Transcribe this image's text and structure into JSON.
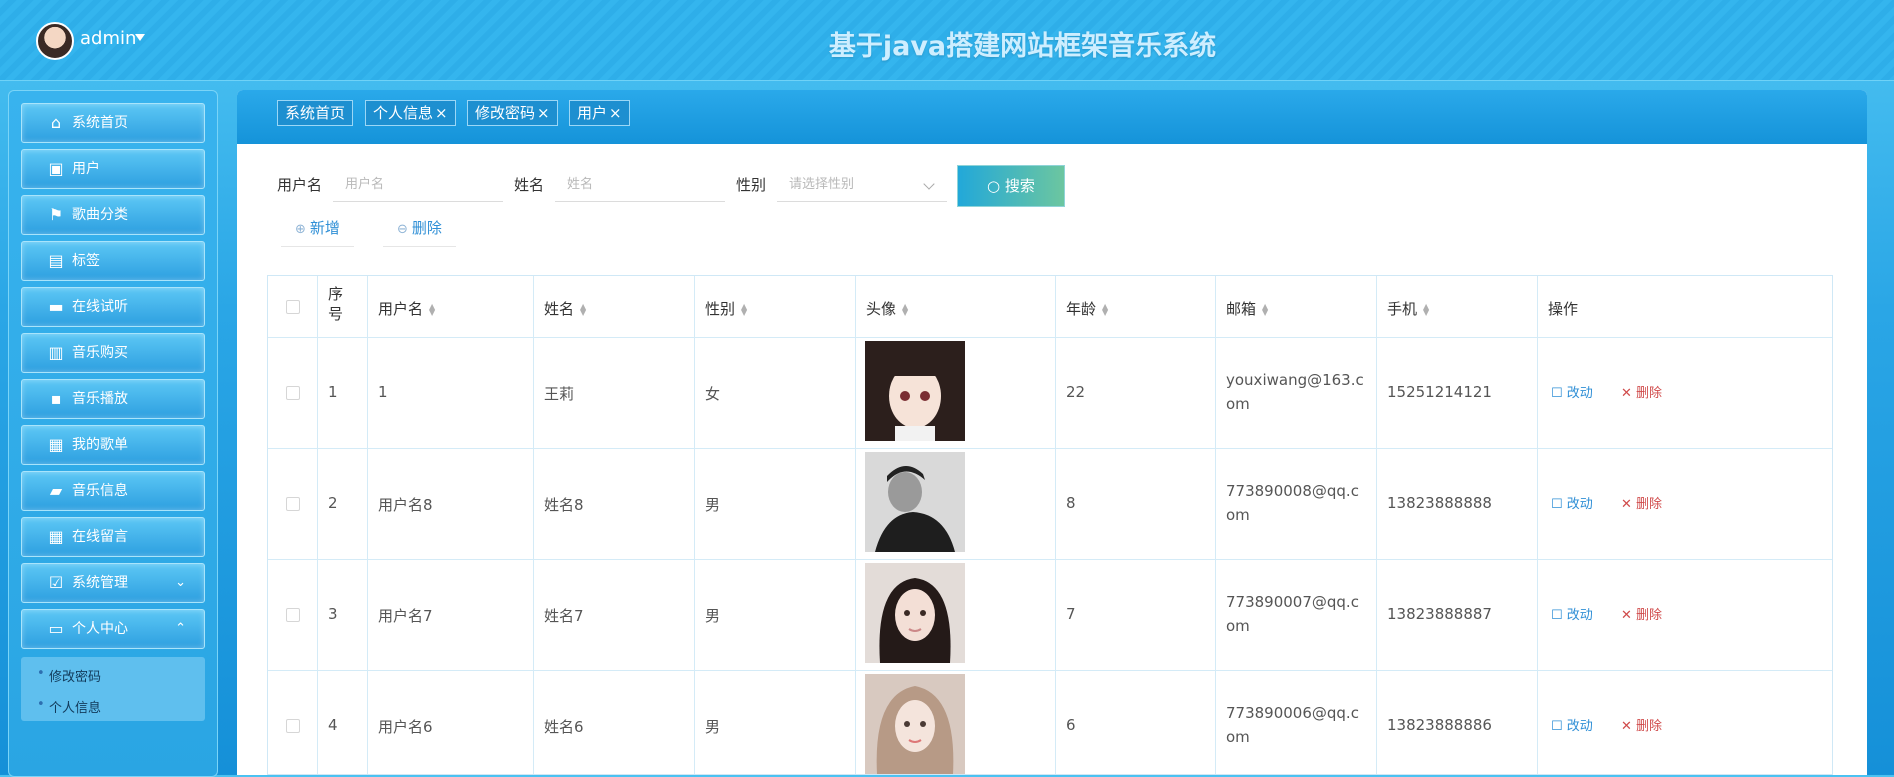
{
  "header": {
    "user": "admin",
    "title": "基于java搭建网站框架音乐系统"
  },
  "sidebar": {
    "items": [
      {
        "label": "系统首页",
        "icon": "home-icon"
      },
      {
        "label": "用户",
        "icon": "user-clipboard-icon"
      },
      {
        "label": "歌曲分类",
        "icon": "flag-icon"
      },
      {
        "label": "标签",
        "icon": "wallet-icon"
      },
      {
        "label": "在线试听",
        "icon": "briefcase-icon"
      },
      {
        "label": "音乐购买",
        "icon": "clipboard-icon"
      },
      {
        "label": "音乐播放",
        "icon": "chat-icon"
      },
      {
        "label": "我的歌单",
        "icon": "grid-icon"
      },
      {
        "label": "音乐信息",
        "icon": "ticket-icon"
      },
      {
        "label": "在线留言",
        "icon": "grid-icon"
      },
      {
        "label": "系统管理",
        "icon": "check-clipboard-icon"
      },
      {
        "label": "个人中心",
        "icon": "wallet-card-icon"
      }
    ],
    "submenu": [
      "修改密码",
      "个人信息"
    ]
  },
  "tabs": [
    "系统首页",
    "个人信息",
    "修改密码",
    "用户"
  ],
  "tab_close": "×",
  "search": {
    "username_label": "用户名",
    "username_placeholder": "用户名",
    "name_label": "姓名",
    "name_placeholder": "姓名",
    "gender_label": "性别",
    "gender_placeholder": "请选择性别",
    "search_button": "搜索"
  },
  "actions": {
    "add": "新增",
    "delete": "删除"
  },
  "table": {
    "headers": {
      "index": "序号",
      "username": "用户名",
      "name": "姓名",
      "gender": "性别",
      "avatar": "头像",
      "age": "年龄",
      "email": "邮箱",
      "phone": "手机",
      "ops": "操作"
    },
    "edit_label": "改动",
    "delete_label": "删除",
    "rows": [
      {
        "index": "1",
        "username": "1",
        "name": "王莉",
        "gender": "女",
        "age": "22",
        "email_l1": "youxiwang@163.c",
        "email_l2": "om",
        "phone": "15251214121"
      },
      {
        "index": "2",
        "username": "用户名8",
        "name": "姓名8",
        "gender": "男",
        "age": "8",
        "email_l1": "773890008@qq.c",
        "email_l2": "om",
        "phone": "13823888888"
      },
      {
        "index": "3",
        "username": "用户名7",
        "name": "姓名7",
        "gender": "男",
        "age": "7",
        "email_l1": "773890007@qq.c",
        "email_l2": "om",
        "phone": "13823888887"
      },
      {
        "index": "4",
        "username": "用户名6",
        "name": "姓名6",
        "gender": "男",
        "age": "6",
        "email_l1": "773890006@qq.c",
        "email_l2": "om",
        "phone": "13823888886"
      }
    ]
  }
}
